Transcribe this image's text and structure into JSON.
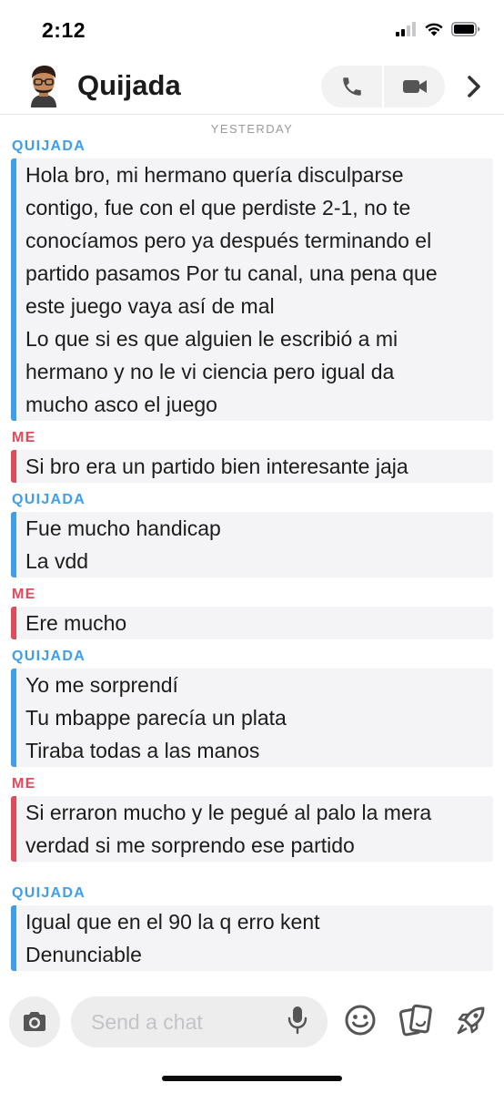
{
  "status_bar": {
    "time": "2:12"
  },
  "header": {
    "contact_name": "Quijada"
  },
  "date_separator": "YESTERDAY",
  "colors": {
    "friend": "#3f9fe6",
    "me": "#e14a5b",
    "bubble_bg": "#f4f4f6"
  },
  "messages": [
    {
      "sender": "QUIJADA",
      "lines": [
        "Hola bro,  mi hermano quería disculparse",
        "contigo, fue con el que perdiste 2-1, no te",
        "conocíamos pero ya después terminando el",
        "partido pasamos Por tu canal, una pena que",
        "este juego vaya así de mal",
        "Lo que si es que alguien le escribió a mi",
        "hermano y no le vi ciencia pero igual da",
        "mucho asco el juego"
      ]
    },
    {
      "sender": "ME",
      "lines": [
        "Si bro era un partido bien interesante jaja"
      ]
    },
    {
      "sender": "QUIJADA",
      "lines": [
        "Fue mucho handicap",
        "La vdd"
      ]
    },
    {
      "sender": "ME",
      "lines": [
        "Ere mucho"
      ]
    },
    {
      "sender": "QUIJADA",
      "lines": [
        "Yo me sorprendí",
        "Tu mbappe parecía un plata",
        "Tiraba todas a las manos"
      ]
    },
    {
      "sender": "ME",
      "lines": [
        "Si erraron mucho y le pegué al palo la mera",
        "verdad si me sorprendo ese partido"
      ]
    },
    {
      "sender": "QUIJADA",
      "lines": [
        "Igual que en el 90  la q erro kent",
        "Denunciable"
      ]
    }
  ],
  "composer": {
    "placeholder": "Send a chat"
  },
  "icons": {
    "camera": "camera-icon",
    "mic": "microphone-icon",
    "emoji": "smiley-icon",
    "stickers": "stickers-icon",
    "games": "rocket-icon",
    "phone": "phone-icon",
    "video": "video-camera-icon",
    "chevron": "chevron-right-icon"
  }
}
